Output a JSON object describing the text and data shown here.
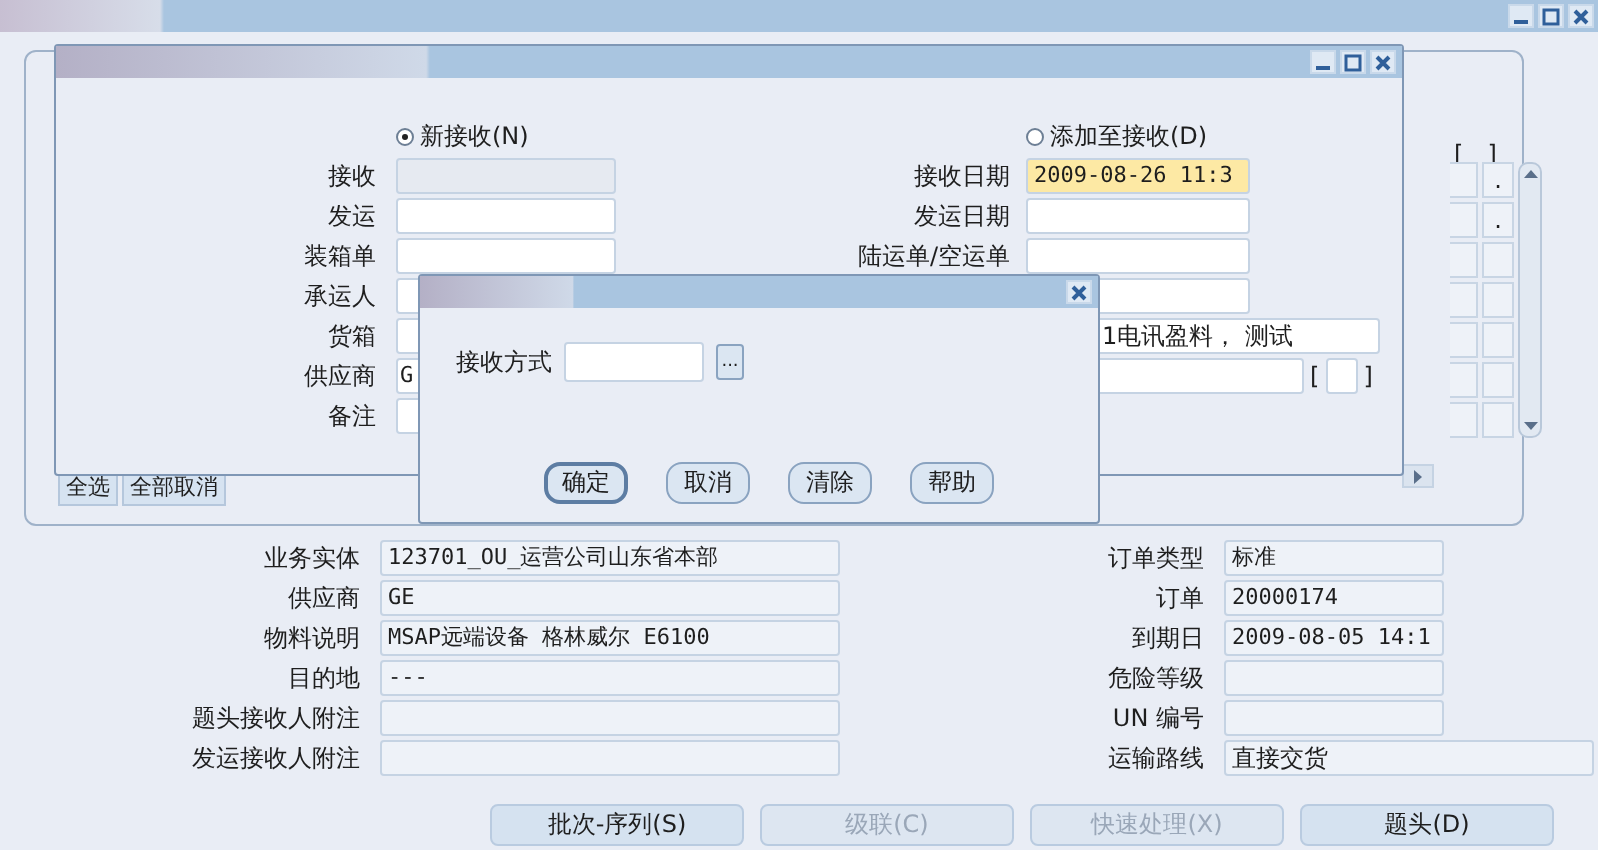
{
  "background_panel": {
    "table": {
      "header": [
        "[",
        "]"
      ],
      "row_values": [
        ".",
        "."
      ]
    },
    "buttons": [
      "全选",
      "全部取消"
    ]
  },
  "receipt_window": {
    "options": [
      {
        "label": "新接收(N)",
        "selected": true
      },
      {
        "label": "添加至接收(D)",
        "selected": false
      }
    ],
    "left_fields": [
      {
        "label": "接收",
        "disabled": true
      },
      {
        "label": "发运",
        "disabled": false
      },
      {
        "label": "装箱单",
        "disabled": false
      },
      {
        "label": "承运人",
        "disabled": false
      },
      {
        "label": "货箱",
        "disabled": false
      },
      {
        "label": "供应商",
        "value": "G",
        "disabled": false
      },
      {
        "label": "备注",
        "disabled": false
      }
    ],
    "right_fields": [
      {
        "kind": "text",
        "label": "接收日期",
        "value": "2009-08-26 11:3",
        "highlighted": true
      },
      {
        "kind": "text",
        "label": "发运日期",
        "highlighted": false
      },
      {
        "kind": "text",
        "label": "陆运单/空运单",
        "highlighted": false
      },
      {
        "kind": "text",
        "highlighted": false
      },
      {
        "kind": "wide",
        "value": "1电讯盈料， 测试",
        "highlighted": false
      },
      {
        "kind": "bracket",
        "open": "[",
        "close": "]",
        "highlighted": false
      }
    ]
  },
  "dialog": {
    "field_label": "接收方式",
    "lookup": "...",
    "buttons": [
      {
        "label": "确定",
        "focused": true
      },
      {
        "label": "取消",
        "focused": false
      },
      {
        "label": "清除",
        "focused": false
      },
      {
        "label": "帮助",
        "focused": false
      }
    ]
  },
  "details": {
    "left": [
      {
        "label": "业务实体",
        "value": "123701_OU_运营公司山东省本部"
      },
      {
        "label": "供应商",
        "value": "GE"
      },
      {
        "label": "物料说明",
        "value": "MSAP远端设备 格林威尔 E6100"
      },
      {
        "label": "目的地",
        "value": "---"
      },
      {
        "label": "题头接收人附注"
      },
      {
        "label": "发运接收人附注"
      }
    ],
    "right": [
      {
        "label": "订单类型",
        "value": "标准"
      },
      {
        "label": "订单",
        "value": "20000174"
      },
      {
        "label": "到期日",
        "value": "2009-08-05 14:1"
      },
      {
        "label": "危险等级"
      },
      {
        "label": "UN 编号"
      },
      {
        "label": "运输路线",
        "value": "直接交货",
        "wide": true
      }
    ]
  },
  "actions": [
    {
      "label": "批次-序列(S)",
      "disabled": false
    },
    {
      "label": "级联(C)",
      "disabled": true
    },
    {
      "label": "快速处理(X)",
      "disabled": true
    },
    {
      "label": "题头(D)",
      "disabled": false
    }
  ]
}
